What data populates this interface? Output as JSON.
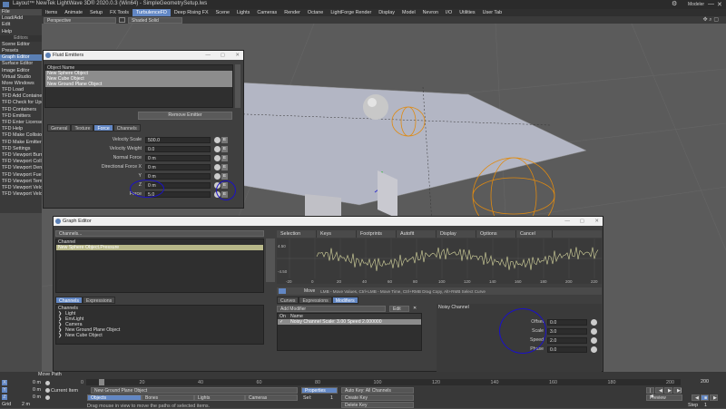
{
  "window": {
    "title": "Layout™ NewTek LightWave 3D® 2020.0.3 (Win64) - SimpleGeometrySetup.lws",
    "mode": "Modeler"
  },
  "left_menu": {
    "top_items": [
      "File",
      "Load/Add",
      "Edit",
      "Help"
    ],
    "section": "Editors",
    "items": [
      "Scene Editor",
      "Presets",
      "Graph Editor",
      "Surface Editor",
      "Image Editor",
      "Virtual Studio",
      "More Windows",
      "TFD Load",
      "TFD Add Container",
      "TFD Check for Upd...",
      "TFD Containers",
      "TFD Emitters",
      "TFD Enter License",
      "TFD Help",
      "TFD Make Collision",
      "TFD Make Emitter",
      "TFD Settings",
      "TFD Viewport Burn",
      "TFD Viewport Collisi...",
      "TFD Viewport Density",
      "TFD Viewport Fuel",
      "TFD Viewport Temp...",
      "TFD Viewport Veloci...",
      "TFD Viewport Veloci..."
    ],
    "selected": "Graph Editor"
  },
  "top_tabs": [
    "Items",
    "Animate",
    "Setup",
    "FX Tools",
    "TurbulenceFD",
    "Deep Rising FX",
    "Scene",
    "Lights",
    "Cameras",
    "Render",
    "Octane",
    "LightForge Render",
    "Display",
    "Model",
    "Nevron",
    "I/O",
    "Utilities",
    "User Tab"
  ],
  "active_top_tab": "TurbulenceFD",
  "viewbar": {
    "view": "Perspective",
    "shading": "Shaded Solid"
  },
  "fluid_emitters": {
    "title": "Fluid Emitters",
    "list_header": "Object Name",
    "objects": [
      "New Sphere Object",
      "New Cube Object",
      "New Ground Plane Object"
    ],
    "remove_label": "Remove Emitter",
    "tabs": [
      "General",
      "Texture",
      "Force",
      "Channels"
    ],
    "active_tab": "Force",
    "fields": [
      {
        "label": "Velocity Scale",
        "value": "500.0"
      },
      {
        "label": "Velocity Weight",
        "value": "0.0"
      },
      {
        "label": "Normal Force",
        "value": "0 m"
      },
      {
        "label": "Directional Force X",
        "value": "0 m"
      },
      {
        "label": "Y",
        "value": "0 m"
      },
      {
        "label": "Z",
        "value": "0 m"
      },
      {
        "label": "Force",
        "value": "5.0"
      }
    ]
  },
  "graph_editor": {
    "title": "Graph Editor",
    "channels_dropdown": "Channels...",
    "channel_header": "Channel",
    "channel_selected": "New Sphere Object.Pressure",
    "menu": [
      "Selection",
      "Keys",
      "Footprints",
      "Autofit",
      "Display",
      "Options",
      "Cancel"
    ],
    "y_ticks": [
      "4.50",
      "-4.50"
    ],
    "x_ticks": [
      "-20",
      "0",
      "20",
      "40",
      "60",
      "80",
      "100",
      "120",
      "140",
      "160",
      "180",
      "200",
      "220"
    ],
    "toolbar_mode": "Move",
    "hint": "LMB - Move Values, Ctrl+LMB - Move Time, Ctrl+RMB Drag Copy, Alt+RMB Select Curve",
    "left_tabs": [
      "Channels",
      "Expressions"
    ],
    "tree_header": "Channels",
    "tree": [
      "Light",
      "EnvLight",
      "Camera",
      "New Ground Plane Object",
      "New Cube Object"
    ],
    "right_tabs": [
      "Curves",
      "Expressions",
      "Modifiers"
    ],
    "active_right_tab": "Modifiers",
    "add_modifier": "Add Modifier",
    "edit_label": "Edit",
    "mod_cols": [
      "On",
      "Name"
    ],
    "modifier_row": "Noisy Channel Scale: 3.00 Speed 2.000000",
    "noisy_title": "Noisy Channel",
    "noisy_fields": [
      {
        "label": "Offset",
        "value": "0.0"
      },
      {
        "label": "Scale",
        "value": "3.0"
      },
      {
        "label": "Speed",
        "value": "2.0"
      },
      {
        "label": "Phase",
        "value": "0.0"
      }
    ]
  },
  "timeline": {
    "move_path": "Move Path",
    "ticks": [
      "0",
      "20",
      "40",
      "60",
      "80",
      "100",
      "120",
      "140",
      "160",
      "180",
      "200"
    ],
    "end": "200",
    "xyz": [
      {
        "axis": "X",
        "value": "0 m"
      },
      {
        "axis": "Y",
        "value": "0 m"
      },
      {
        "axis": "Z",
        "value": "0 m"
      }
    ],
    "grid_label": "Grid",
    "grid_value": "2 m",
    "current_item_label": "Current Item",
    "current_item": "New Ground Plane Object",
    "objects": "Objects",
    "bones": "Bones",
    "lights": "Lights",
    "cameras": "Cameras",
    "properties": "Properties",
    "sel_label": "Sel:",
    "sel_value": "1",
    "auto_key": "Auto Key: All Channels",
    "create_key": "Create Key",
    "delete_key": "Delete Key",
    "preview": "Preview",
    "step_label": "Step",
    "step_value": "1",
    "status": "Drag mouse in view to move the paths of selected items."
  }
}
